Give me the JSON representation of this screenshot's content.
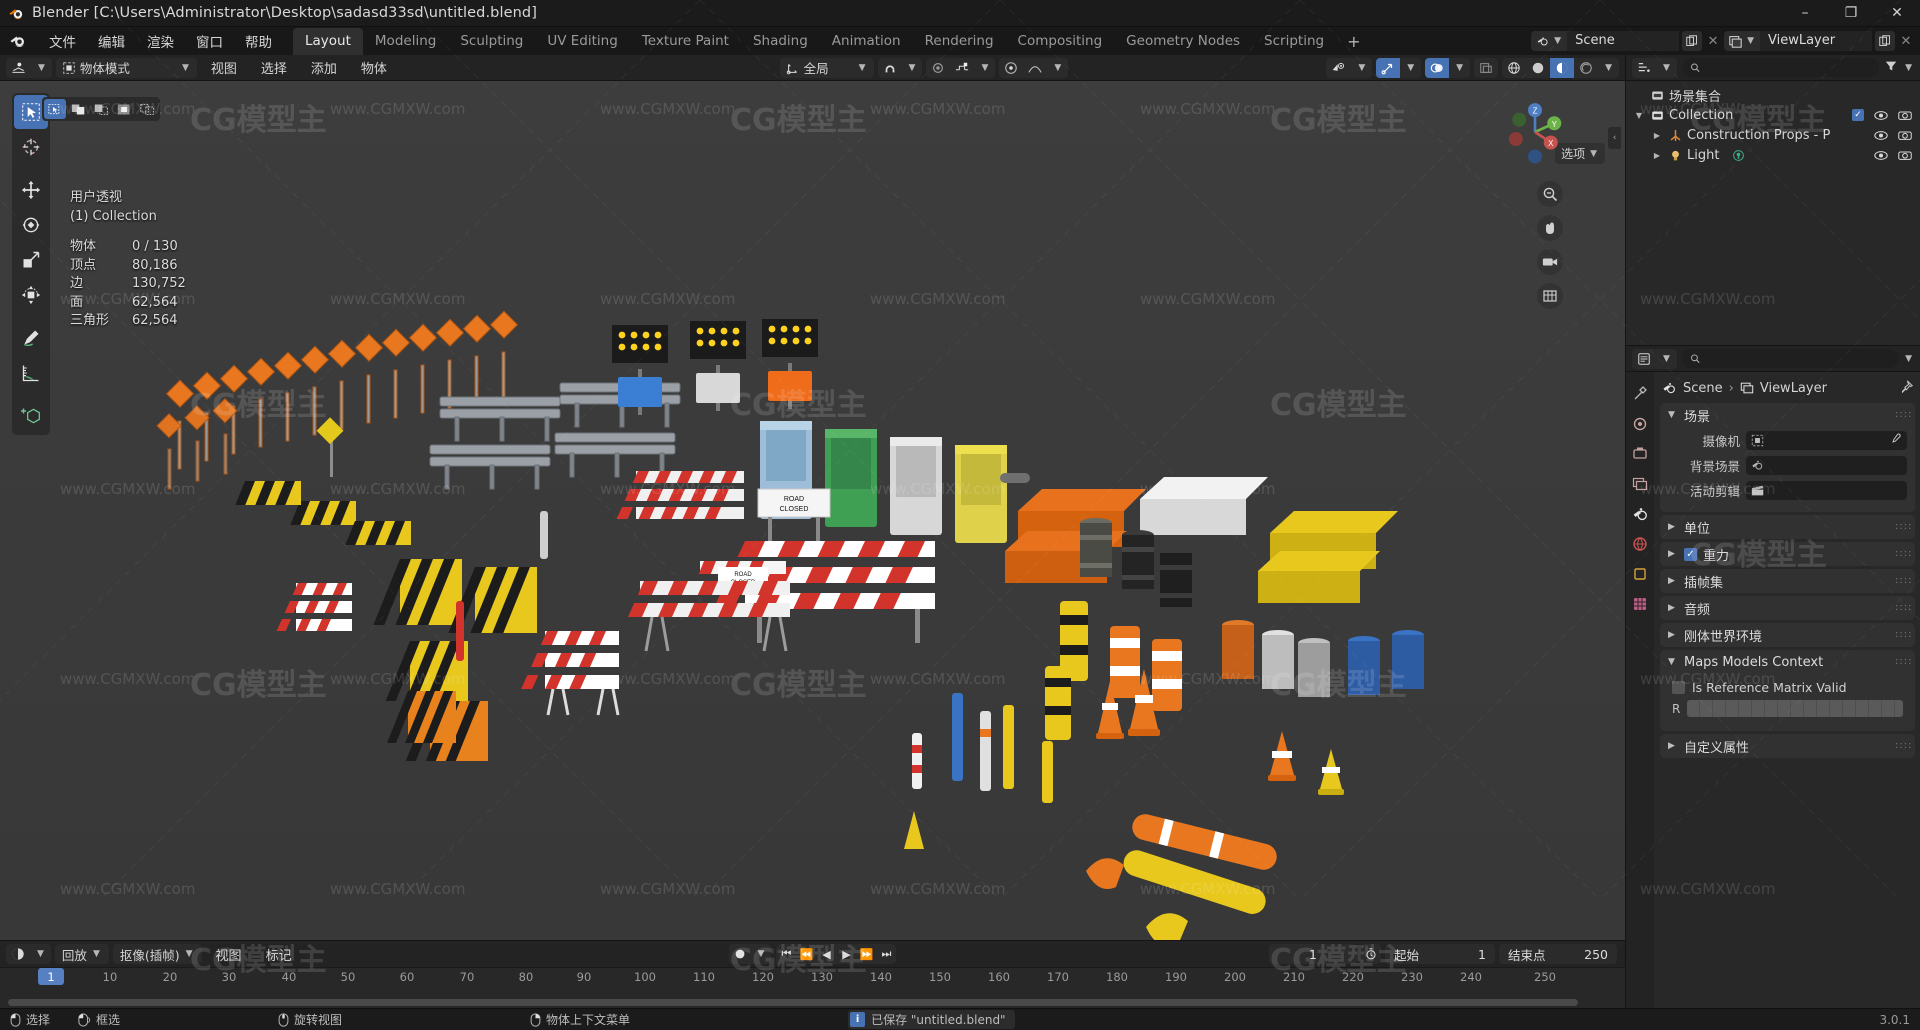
{
  "window": {
    "title": "Blender [C:\\Users\\Administrator\\Desktop\\sadasd33sd\\untitled.blend]",
    "minimize": "–",
    "maximize": "❐",
    "close": "✕"
  },
  "topbar": {
    "menus": [
      "文件",
      "编辑",
      "渲染",
      "窗口",
      "帮助"
    ],
    "tabs": [
      {
        "label": "Layout",
        "active": true
      },
      {
        "label": "Modeling",
        "active": false
      },
      {
        "label": "Sculpting",
        "active": false
      },
      {
        "label": "UV Editing",
        "active": false
      },
      {
        "label": "Texture Paint",
        "active": false
      },
      {
        "label": "Shading",
        "active": false
      },
      {
        "label": "Animation",
        "active": false
      },
      {
        "label": "Rendering",
        "active": false
      },
      {
        "label": "Compositing",
        "active": false
      },
      {
        "label": "Geometry Nodes",
        "active": false
      },
      {
        "label": "Scripting",
        "active": false
      }
    ],
    "add_tab": "+",
    "scene_name": "Scene",
    "viewlayer_name": "ViewLayer",
    "new_copy": "⧉",
    "unlink": "✕"
  },
  "viewport": {
    "header": {
      "editor_type": "editor-type-3d-viewport",
      "mode": "物体模式",
      "menus": [
        "视图",
        "选择",
        "添加",
        "物体"
      ],
      "transform_orientation": "全局",
      "snap_label": "snap",
      "proportional_label": "proportional"
    },
    "tools": [
      {
        "name": "tweak-tool",
        "active": true
      },
      {
        "name": "cursor-tool",
        "active": false
      },
      {
        "name": "move-tool",
        "active": false
      },
      {
        "name": "rotate-tool",
        "active": false
      },
      {
        "name": "scale-tool",
        "active": false
      },
      {
        "name": "transform-tool",
        "active": false
      },
      {
        "name": "annotate-tool",
        "active": false
      },
      {
        "name": "measure-tool",
        "active": false
      },
      {
        "name": "add-cube-tool",
        "active": false
      }
    ],
    "select_modes": [
      "set",
      "extend",
      "subtract",
      "invert",
      "intersect"
    ],
    "stats": {
      "view_name": "用户透视",
      "collection": "(1) Collection",
      "rows": [
        {
          "key": "物体",
          "value": "0 / 130"
        },
        {
          "key": "顶点",
          "value": "80,186"
        },
        {
          "key": "边",
          "value": "130,752"
        },
        {
          "key": "面",
          "value": "62,564"
        },
        {
          "key": "三角形",
          "value": "62,564"
        }
      ]
    },
    "gizmo": {
      "x": "X",
      "y": "Y",
      "z": "Z"
    },
    "options_label": "选项",
    "shading_modes": [
      "wireframe",
      "solid",
      "material-preview",
      "rendered"
    ],
    "active_shading": "material-preview"
  },
  "outliner": {
    "display_mode": "view-layer",
    "search_placeholder": "",
    "filter_icon": "filter-icon",
    "rows": [
      {
        "label": "场景集合",
        "indent": 0,
        "icon": "collection-icon",
        "expanded": null,
        "checkbox": false,
        "eye": false,
        "camera": false
      },
      {
        "label": "Collection",
        "indent": 1,
        "icon": "collection-icon",
        "expanded": true,
        "checkbox": true,
        "eye": true,
        "camera": true
      },
      {
        "label": "Construction Props - P",
        "indent": 2,
        "icon": "empty-axes-icon",
        "expanded": false,
        "checkbox": false,
        "eye": true,
        "camera": true
      },
      {
        "label": "Light",
        "indent": 2,
        "icon": "light-icon",
        "expanded": false,
        "checkbox": false,
        "eye": true,
        "camera": true,
        "extra_icon": "light-data-icon"
      }
    ]
  },
  "properties": {
    "breadcrumb": [
      "Scene",
      "ViewLayer"
    ],
    "tabs": [
      "tool-tab",
      "render-tab",
      "output-tab",
      "view-layer-tab",
      "scene-tab",
      "world-tab",
      "object-tab",
      "texture-tab"
    ],
    "active_tab": "scene-tab",
    "panels": [
      {
        "name": "场景",
        "expanded": true,
        "fields": [
          {
            "label": "摄像机",
            "value": "",
            "icon": "camera-icon",
            "eyedropper": true
          },
          {
            "label": "背景场景",
            "value": "",
            "icon": "scene-icon",
            "eyedropper": false
          },
          {
            "label": "活动剪辑",
            "value": "",
            "icon": "clip-icon",
            "eyedropper": false
          }
        ]
      },
      {
        "name": "单位",
        "expanded": false,
        "fields": []
      },
      {
        "name": "重力",
        "expanded": false,
        "checkbox": true,
        "fields": []
      },
      {
        "name": "插帧集",
        "expanded": false,
        "fields": []
      },
      {
        "name": "音频",
        "expanded": false,
        "fields": []
      },
      {
        "name": "刚体世界环境",
        "expanded": false,
        "fields": []
      },
      {
        "name": "Maps Models Context",
        "expanded": true,
        "checkbox_label": "Is Reference Matrix Valid",
        "checkbox_value": false,
        "matrix_key": "R"
      },
      {
        "name": "自定义属性",
        "expanded": false,
        "fields": []
      }
    ]
  },
  "timeline": {
    "editor_type": "editor-type-timeline",
    "menus": [
      "回放",
      "抠像(插帧)",
      "视图",
      "标记"
    ],
    "playback_label": "回放",
    "keying_label": "抠像(插帧)",
    "current_frame": "1",
    "start_label": "起始",
    "start_value": "1",
    "end_label": "结束点",
    "end_value": "250",
    "playhead_frame": "1",
    "ticks": [
      "1",
      "10",
      "20",
      "30",
      "40",
      "50",
      "60",
      "70",
      "80",
      "90",
      "100",
      "110",
      "120",
      "130",
      "140",
      "150",
      "160",
      "170",
      "180",
      "190",
      "200",
      "210",
      "220",
      "230",
      "240",
      "250"
    ]
  },
  "statusbar": {
    "items": [
      {
        "icon": "mouse-left-icon",
        "label": "选择"
      },
      {
        "icon": "mouse-left-drag-icon",
        "label": "框选"
      },
      {
        "icon": "mouse-middle-icon",
        "label": "旋转视图"
      },
      {
        "icon": "mouse-right-icon",
        "label": "物体上下文菜单"
      }
    ],
    "report": "已保存 \"untitled.blend\"",
    "version": "3.0.1"
  },
  "watermark": {
    "texts": [
      "www.CGMXW.com",
      "CG模型主"
    ]
  },
  "colors": {
    "accent": "#4772b3",
    "header": "#232323",
    "panel": "#313131",
    "viewport_bg": "#3b3b3b",
    "text": "#d6d6d6"
  }
}
